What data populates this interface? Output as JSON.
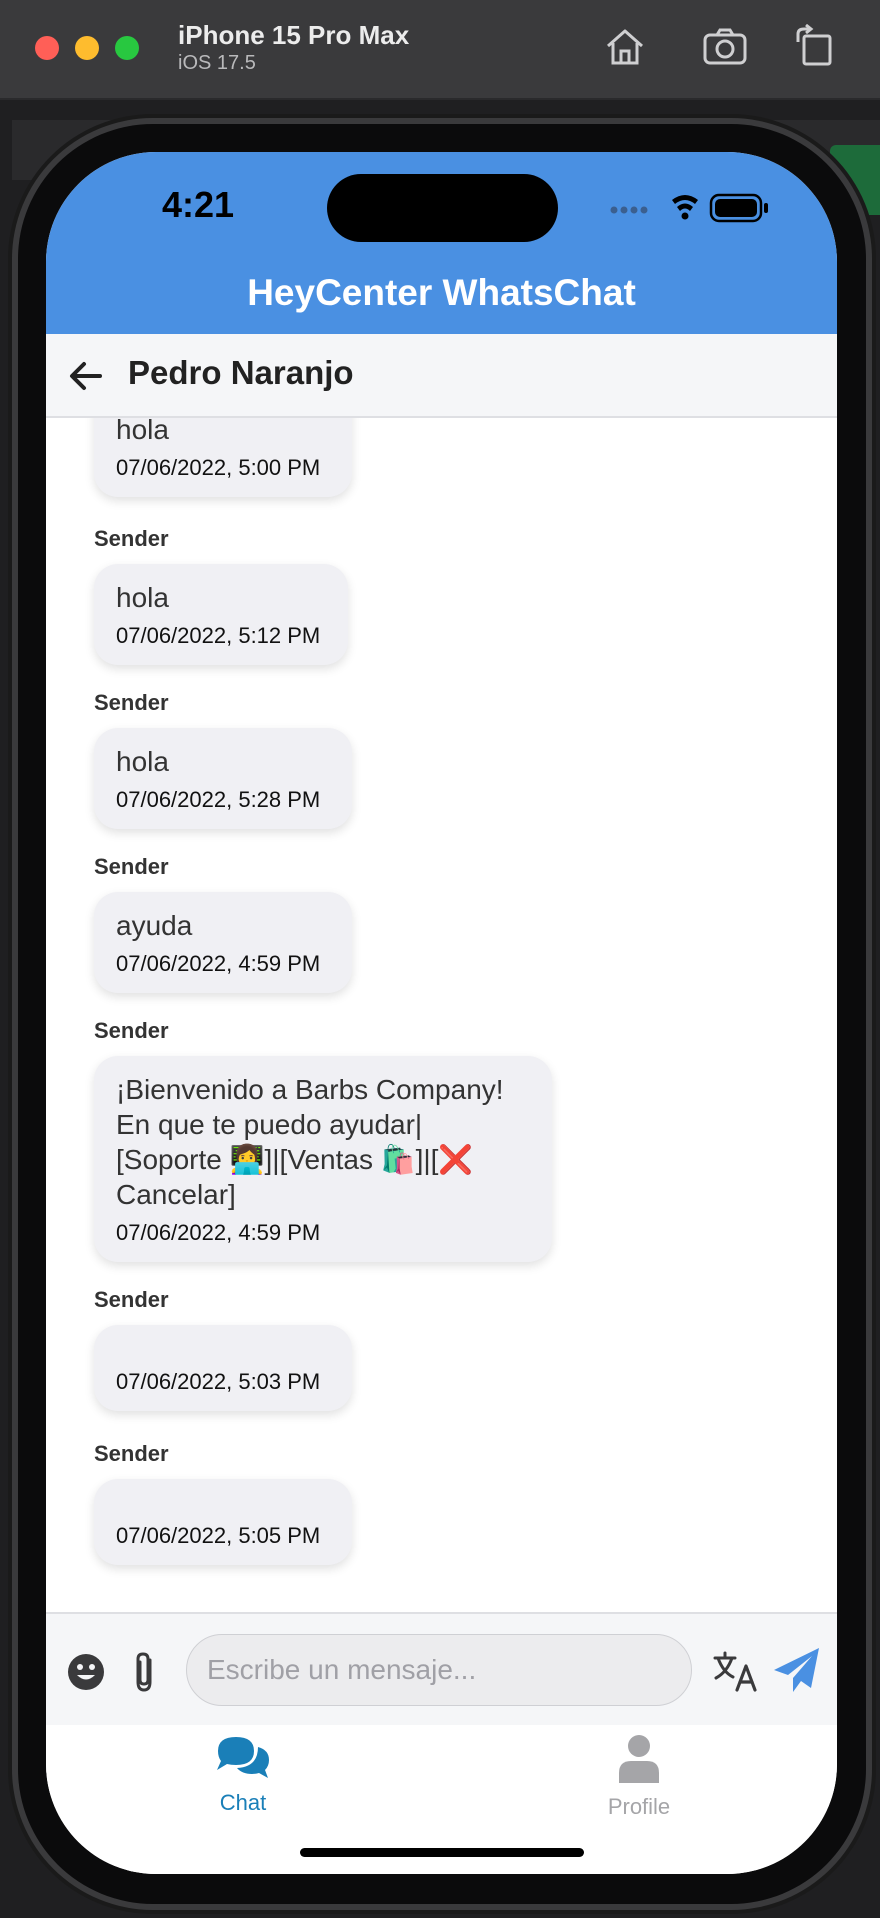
{
  "window": {
    "device_name": "iPhone 15 Pro Max",
    "os_version": "iOS 17.5"
  },
  "status_bar": {
    "time": "4:21"
  },
  "app": {
    "title": "HeyCenter WhatsChat"
  },
  "chat": {
    "contact_name": "Pedro Naranjo"
  },
  "messages": [
    {
      "sender": "",
      "text": "hola",
      "time": "07/06/2022, 5:00 PM"
    },
    {
      "sender": "Sender",
      "text": "hola",
      "time": "07/06/2022, 5:12 PM"
    },
    {
      "sender": "Sender",
      "text": "hola",
      "time": "07/06/2022, 5:28 PM"
    },
    {
      "sender": "Sender",
      "text": "ayuda",
      "time": "07/06/2022, 4:59 PM"
    },
    {
      "sender": "Sender",
      "text": "¡Bienvenido a Barbs Company!\nEn que te puedo ayudar|\n[Soporte 👩‍💻]|[Ventas 🛍️]|[❌\nCancelar]",
      "time": "07/06/2022, 4:59 PM"
    },
    {
      "sender": "Sender",
      "text": "",
      "time": "07/06/2022, 5:03 PM"
    },
    {
      "sender": "Sender",
      "text": "",
      "time": "07/06/2022, 5:05 PM"
    }
  ],
  "composer": {
    "placeholder": "Escribe un mensaje..."
  },
  "tabs": [
    {
      "label": "Chat",
      "active": true,
      "icon": "chat-bubbles-icon"
    },
    {
      "label": "Profile",
      "active": false,
      "icon": "user-icon"
    }
  ],
  "colors": {
    "header": "#4a90e2",
    "active_tab": "#1a7fb8",
    "inactive_tab": "#a5a5a8",
    "send": "#4a90e2",
    "bubble": "#f0f0f4"
  }
}
